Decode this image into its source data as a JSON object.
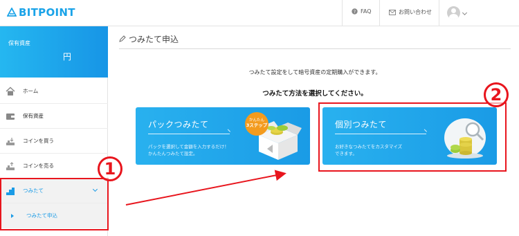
{
  "header": {
    "logo_text": "BITPOINT",
    "faq_label": "FAQ",
    "contact_label": "お問い合わせ"
  },
  "sidebar": {
    "asset_card": {
      "label": "保有資産",
      "value": "円"
    },
    "items": [
      {
        "label": "ホーム",
        "icon": "home-icon"
      },
      {
        "label": "保有資産",
        "icon": "wallet-icon"
      },
      {
        "label": "コインを買う",
        "icon": "coin-buy-icon"
      },
      {
        "label": "コインを売る",
        "icon": "coin-sell-icon"
      },
      {
        "label": "つみたて",
        "icon": "coin-stack-icon"
      }
    ],
    "sub_item": {
      "label": "つみたて申込"
    }
  },
  "main": {
    "page_title": "つみたて申込",
    "intro_text": "つみたて設定をして暗号資産の定期購入ができます。",
    "choose_text": "つみたて方法を選択してください。",
    "cards": [
      {
        "title": "パックつみたて",
        "desc_line1": "パックを選択して金額を入力するだけ！",
        "desc_line2": "かんたんつみたて設定。",
        "badge_line1": "かんたん",
        "badge_line2": "3ステップ"
      },
      {
        "title": "個別つみたて",
        "desc_line1": "お好きなつみたてをカスタマイズ",
        "desc_line2": "できます。"
      }
    ]
  },
  "annotations": {
    "step1": "1",
    "step2": "2"
  },
  "colors": {
    "accent": "#1a9be6",
    "annotation_red": "#e8151d",
    "badge_orange": "#f39b1e"
  }
}
